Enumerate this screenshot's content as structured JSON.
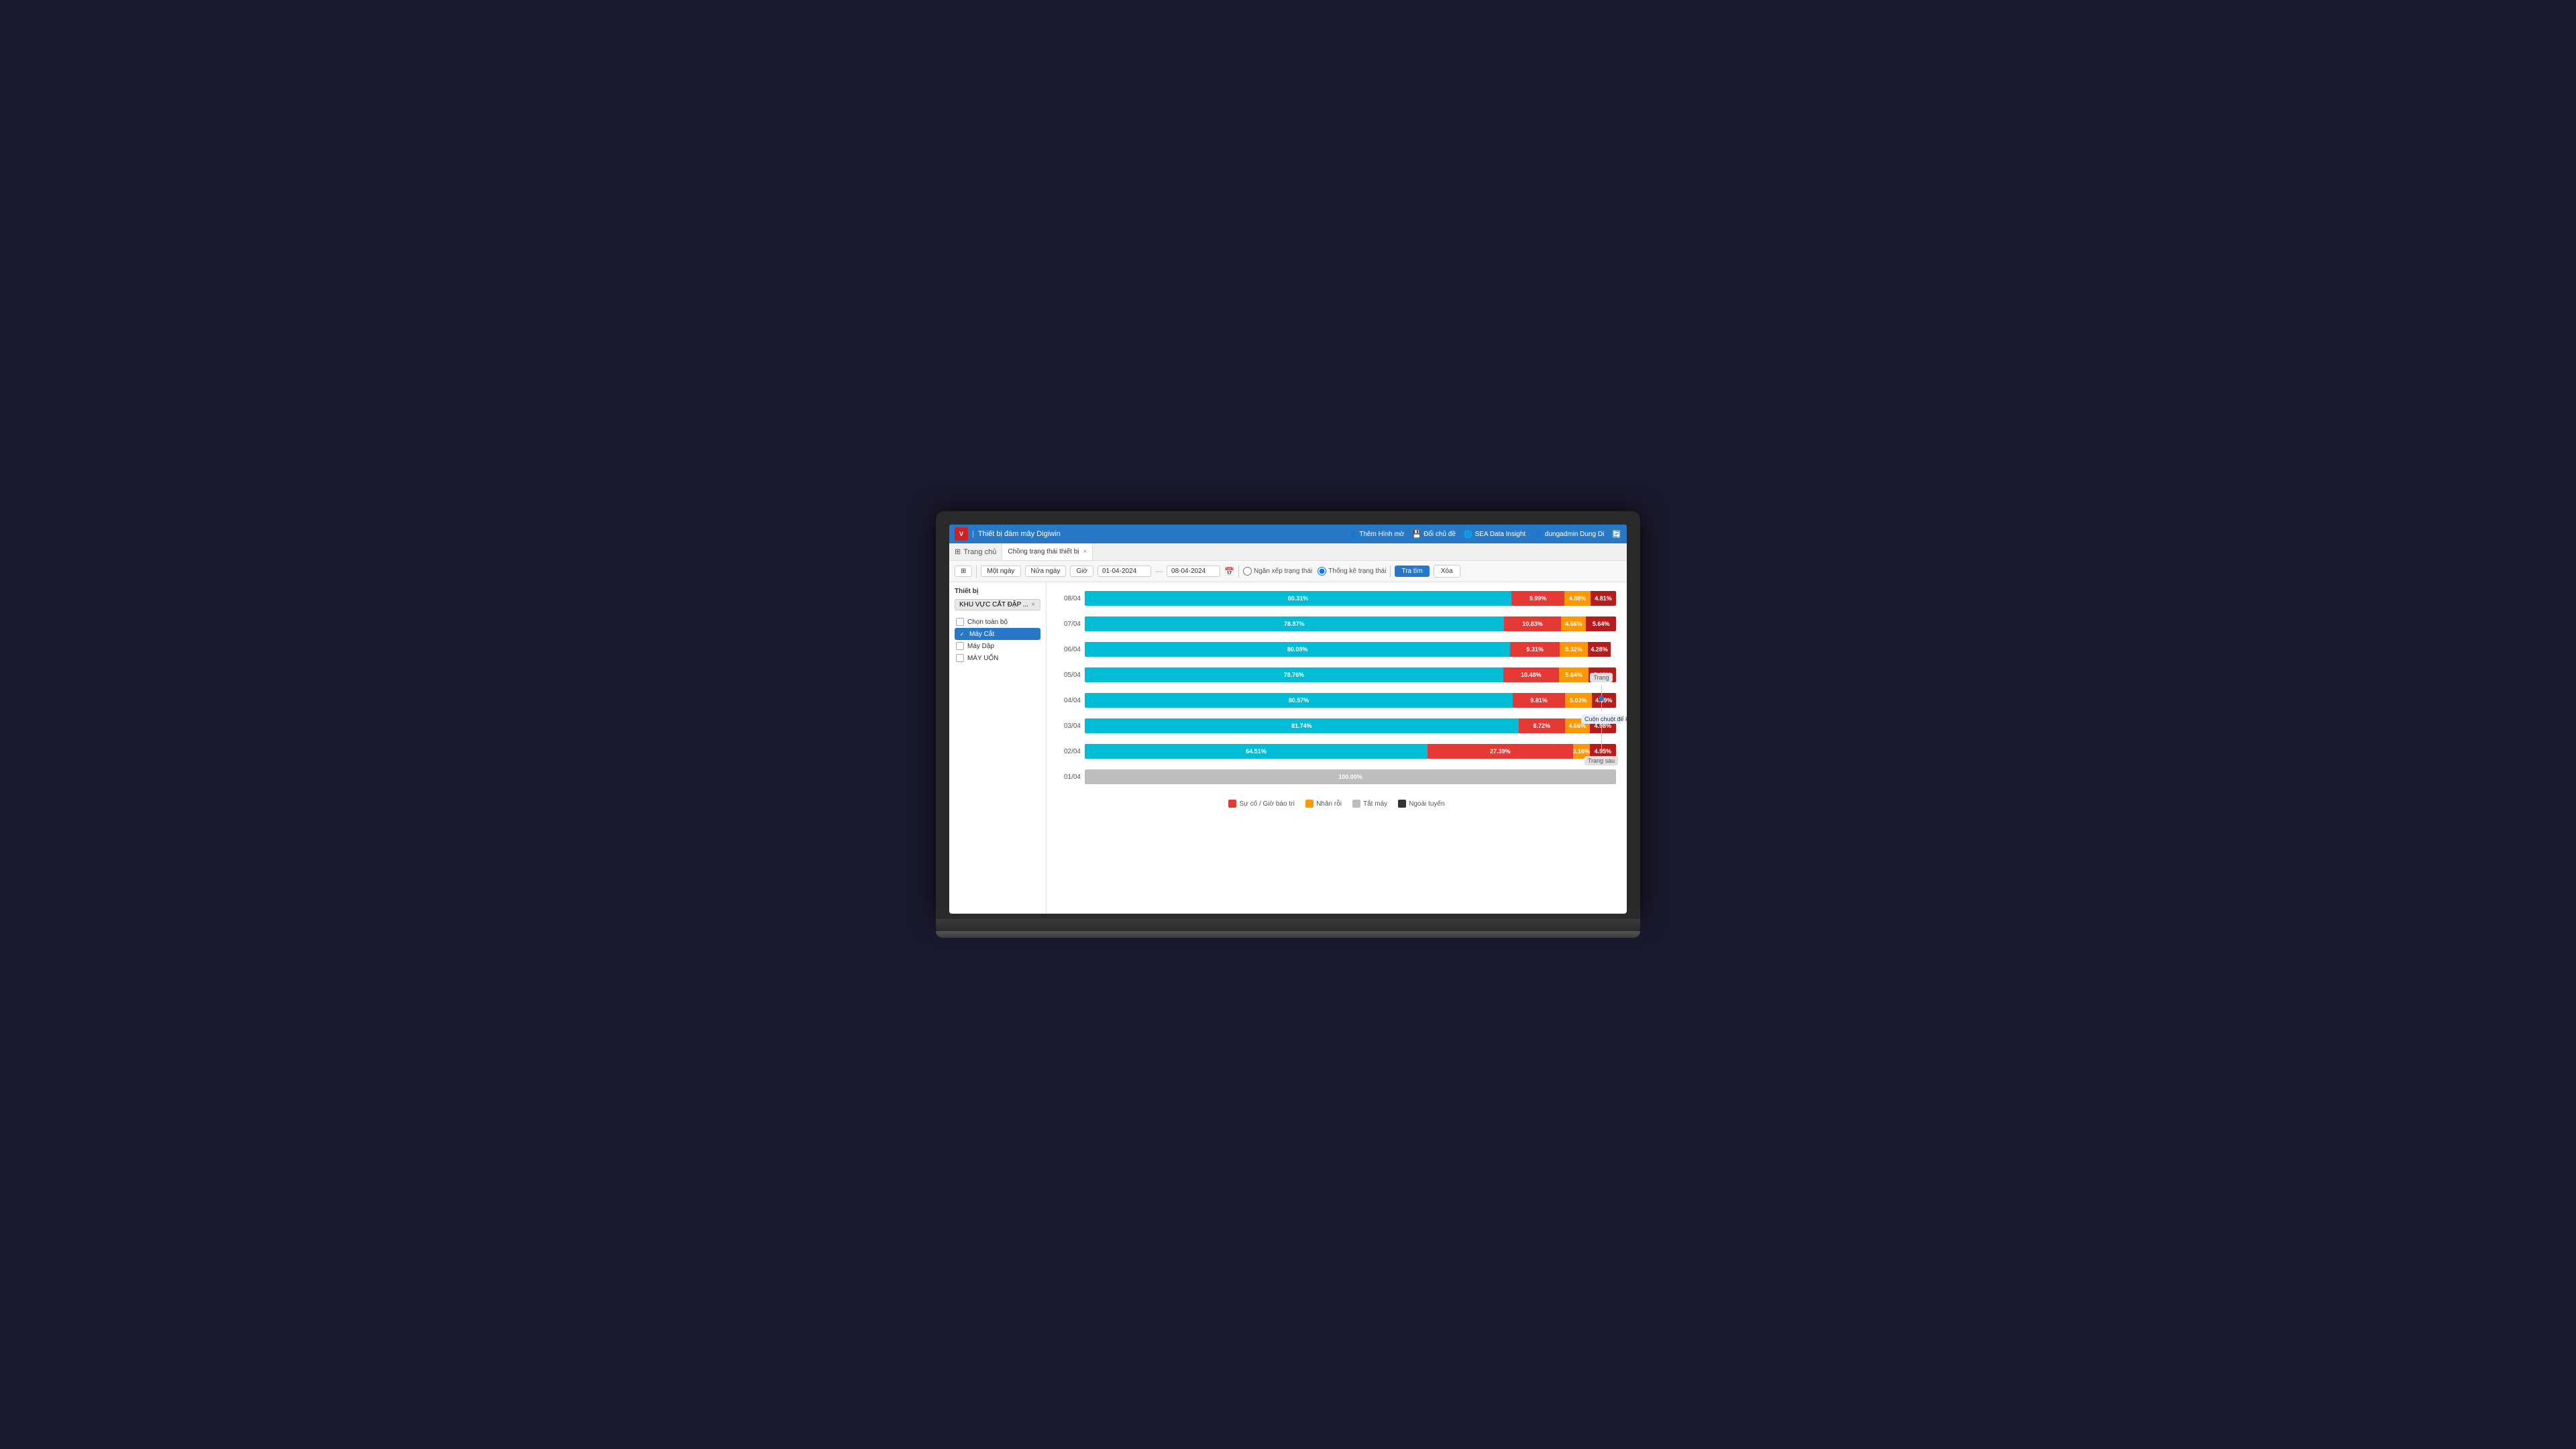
{
  "app": {
    "logo_text": "V",
    "title_separator": "|",
    "title": "Thiết bị đám mây Digiwin"
  },
  "titlebar": {
    "actions": [
      {
        "icon": "👤",
        "label": "Thêm Hình mờ"
      },
      {
        "icon": "💾",
        "label": "Đổi chủ đề"
      },
      {
        "icon": "🌐",
        "label": "SEA Data Insight"
      },
      {
        "icon": "👤",
        "label": "dungadmin Dung Di"
      },
      {
        "icon": "🔄",
        "label": ""
      }
    ]
  },
  "tabs": {
    "home_label": "Trang chủ",
    "active_tab_label": "Chồng trạng thái thiết bị",
    "close_icon": "×"
  },
  "toolbar": {
    "time_buttons": [
      "Một ngày",
      "Nửa ngày",
      "Giờ"
    ],
    "date_from": "01-04-2024",
    "date_to": "08-04-2024",
    "radio_options": [
      "Ngăn xếp trạng thái",
      "Thống kê trạng thái"
    ],
    "selected_radio": 1,
    "search_label": "Tra tìm",
    "delete_label": "Xóa",
    "grid_icon": "⊞"
  },
  "sidebar": {
    "title": "Thiết bị",
    "filter_tag": "KHU VỰC CẮT ĐẬP ...",
    "items": [
      {
        "label": "Chọn toàn bộ",
        "checked": false
      },
      {
        "label": "Máy Cắt",
        "checked": true,
        "active": true
      },
      {
        "label": "Máy Dập",
        "checked": false
      },
      {
        "label": "MÁY UỐN",
        "checked": false
      }
    ]
  },
  "chart": {
    "rows": [
      {
        "date": "08/04",
        "segments": [
          {
            "type": "cyan",
            "width": 80.31,
            "label": "80.31%"
          },
          {
            "type": "red",
            "width": 9.99,
            "label": "9.99%"
          },
          {
            "type": "orange",
            "width": 4.88,
            "label": "4.88%"
          },
          {
            "type": "dark-red",
            "width": 4.81,
            "label": "4.81%"
          }
        ]
      },
      {
        "date": "07/04",
        "segments": [
          {
            "type": "cyan",
            "width": 78.87,
            "label": "78.87%"
          },
          {
            "type": "red",
            "width": 10.83,
            "label": "10.83%"
          },
          {
            "type": "orange",
            "width": 4.66,
            "label": "4.66%"
          },
          {
            "type": "dark-red",
            "width": 5.64,
            "label": "5.64%"
          }
        ]
      },
      {
        "date": "06/04",
        "segments": [
          {
            "type": "cyan",
            "width": 80.08,
            "label": "80.08%"
          },
          {
            "type": "red",
            "width": 9.31,
            "label": "9.31%"
          },
          {
            "type": "orange",
            "width": 5.32,
            "label": "5.32%"
          },
          {
            "type": "dark-red",
            "width": 4.28,
            "label": "4.28%"
          }
        ]
      },
      {
        "date": "05/04",
        "segments": [
          {
            "type": "cyan",
            "width": 78.76,
            "label": "78.76%"
          },
          {
            "type": "red",
            "width": 10.48,
            "label": "10.48%"
          },
          {
            "type": "orange",
            "width": 5.64,
            "label": "5.64%"
          },
          {
            "type": "dark-red",
            "width": 5.12,
            "label": "5.12%"
          }
        ]
      },
      {
        "date": "04/04",
        "segments": [
          {
            "type": "cyan",
            "width": 80.57,
            "label": "80.57%"
          },
          {
            "type": "red",
            "width": 9.81,
            "label": "9.81%"
          },
          {
            "type": "orange",
            "width": 5.03,
            "label": "5.03%"
          },
          {
            "type": "dark-red",
            "width": 4.59,
            "label": "4.59%"
          }
        ]
      },
      {
        "date": "03/04",
        "segments": [
          {
            "type": "cyan",
            "width": 81.74,
            "label": "81.74%"
          },
          {
            "type": "red",
            "width": 8.72,
            "label": "8.72%"
          },
          {
            "type": "orange",
            "width": 4.66,
            "label": "4.66%"
          },
          {
            "type": "dark-red",
            "width": 4.98,
            "label": "4.98%"
          }
        ]
      },
      {
        "date": "02/04",
        "segments": [
          {
            "type": "cyan",
            "width": 64.51,
            "label": "64.51%"
          },
          {
            "type": "red",
            "width": 27.39,
            "label": "27.39%"
          },
          {
            "type": "orange",
            "width": 3.16,
            "label": "3.16%"
          },
          {
            "type": "dark-red",
            "width": 4.95,
            "label": "4.95%"
          }
        ]
      },
      {
        "date": "01/04",
        "segments": [
          {
            "type": "gray",
            "width": 100,
            "label": "100.00%"
          }
        ]
      }
    ],
    "legend": [
      {
        "color": "#e53935",
        "label": "Sự cố / Giờ báo trì"
      },
      {
        "color": "#ff9800",
        "label": "Nhân rỗi"
      },
      {
        "color": "#bdbdbd",
        "label": "Tắt máy"
      },
      {
        "color": "#333333",
        "label": "Ngoài tuyến"
      }
    ]
  },
  "scroll_hint": {
    "top_label": "Trang",
    "middle_text": "Cuộn chuột để kiểm tra",
    "bottom_label": "Trang sau"
  }
}
